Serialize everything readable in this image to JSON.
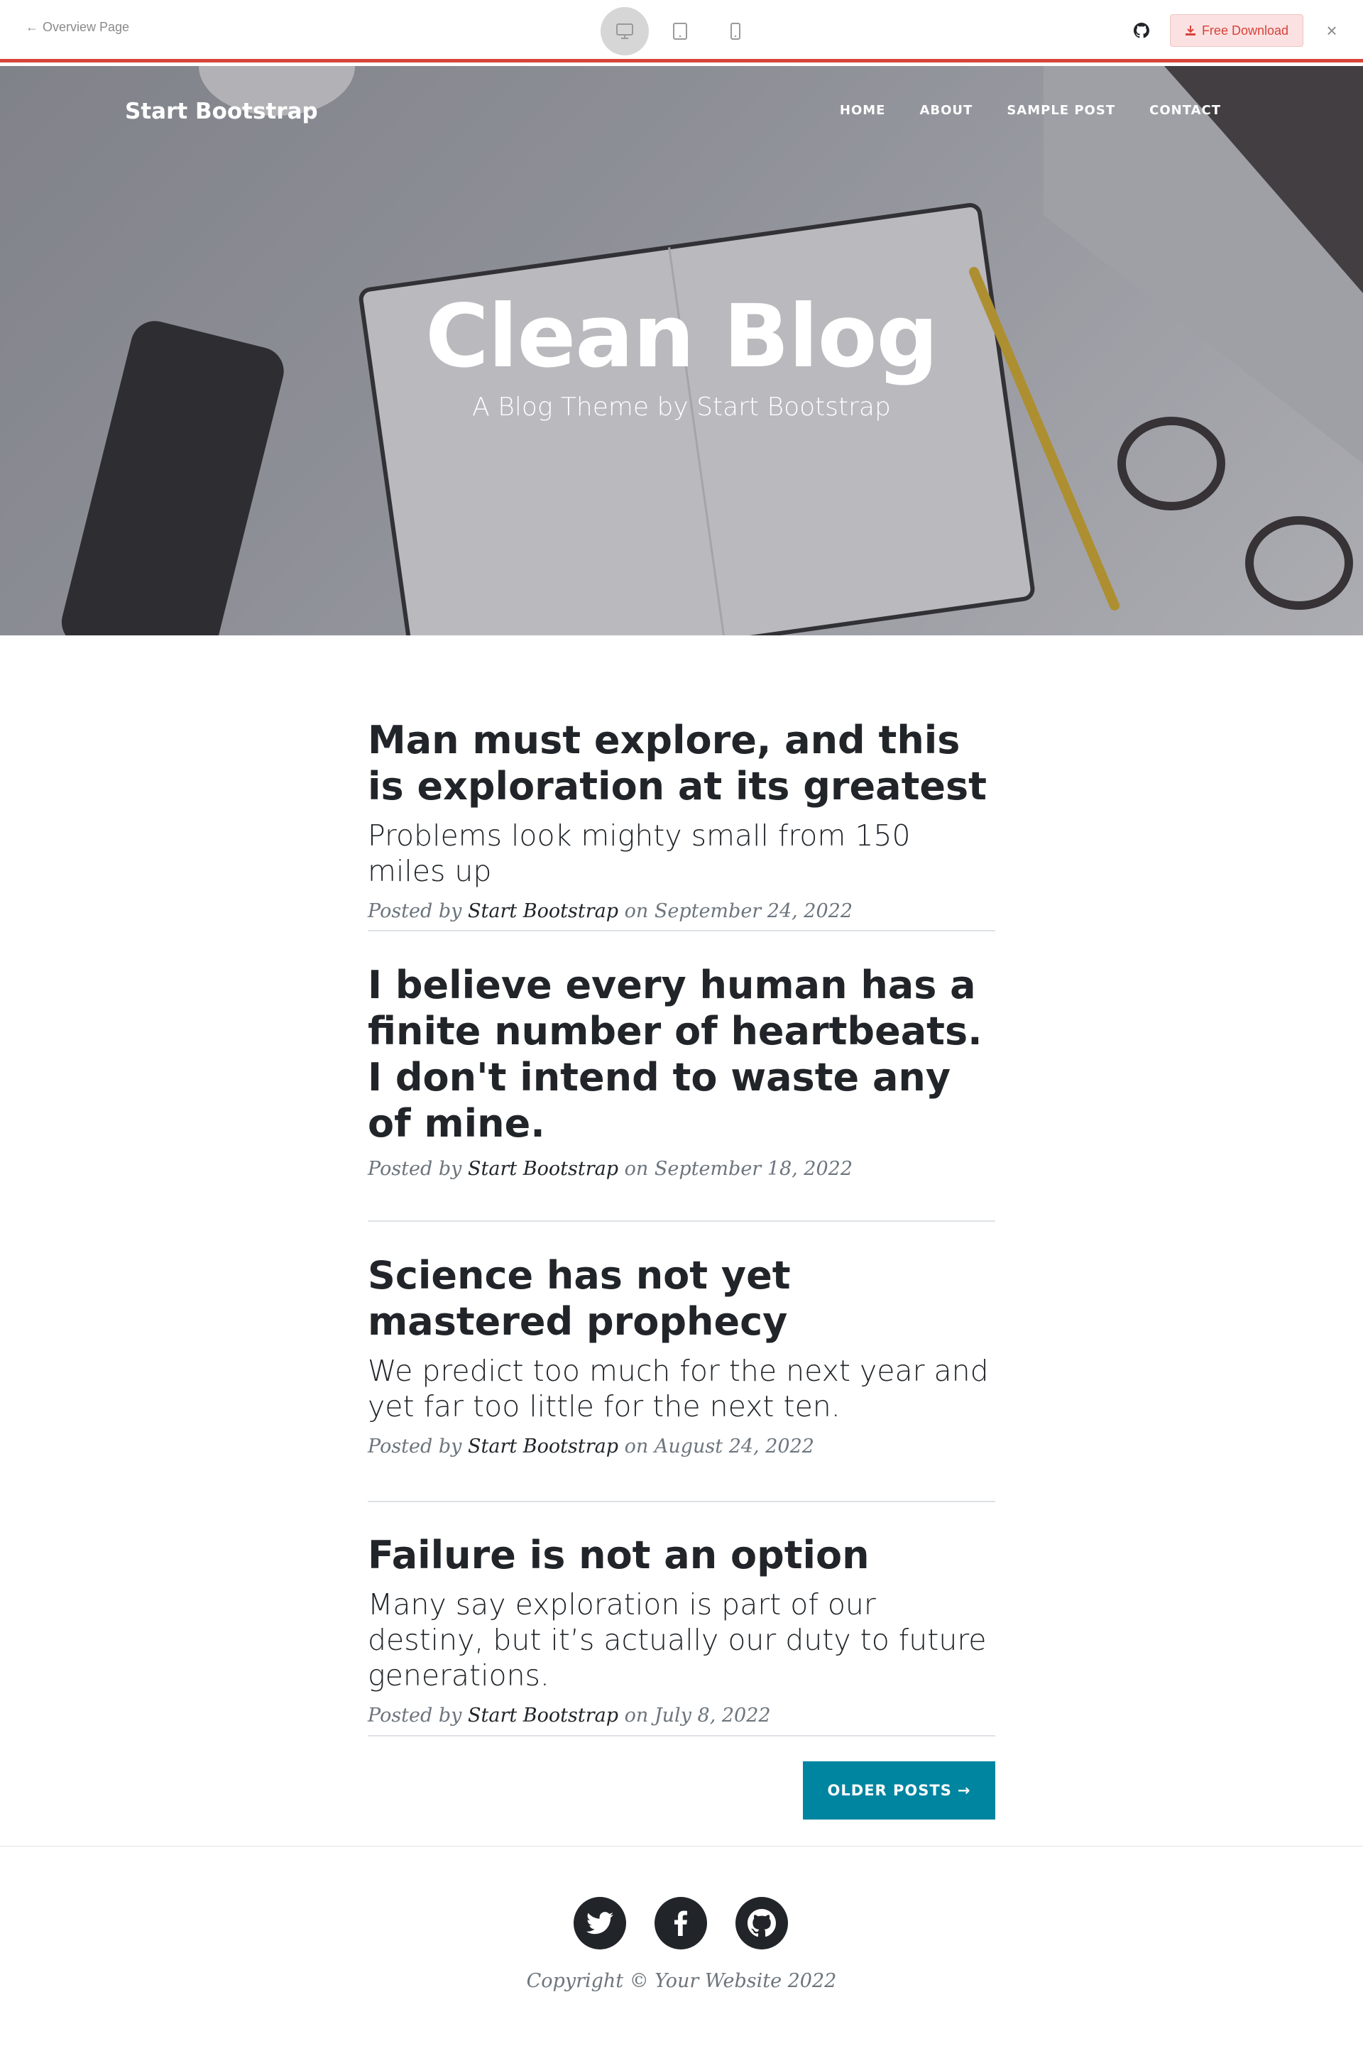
{
  "topbar": {
    "back_label": "Overview Page",
    "download_label": "Free Download",
    "accent_color": "#d9443a"
  },
  "nav": {
    "brand": "Start Bootstrap",
    "links": [
      "HOME",
      "ABOUT",
      "SAMPLE POST",
      "CONTACT"
    ]
  },
  "hero": {
    "title": "Clean Blog",
    "subtitle": "A Blog Theme by Start Bootstrap"
  },
  "posts": [
    {
      "title": "Man must explore, and this is exploration at its greatest",
      "subtitle": "Problems look mighty small from 150 miles up",
      "posted_by": "Posted by",
      "author": "Start Bootstrap",
      "on": "on",
      "date": "September 24, 2022"
    },
    {
      "title": "I believe every human has a finite number of heartbeats. I don't intend to waste any of mine.",
      "subtitle": "",
      "posted_by": "Posted by",
      "author": "Start Bootstrap",
      "on": "on",
      "date": "September 18, 2022"
    },
    {
      "title": "Science has not yet mastered prophecy",
      "subtitle": "We predict too much for the next year and yet far too little for the next ten.",
      "posted_by": "Posted by",
      "author": "Start Bootstrap",
      "on": "on",
      "date": "August 24, 2022"
    },
    {
      "title": "Failure is not an option",
      "subtitle": "Many say exploration is part of our destiny, but it’s actually our duty to future generations.",
      "posted_by": "Posted by",
      "author": "Start Bootstrap",
      "on": "on",
      "date": "July 8, 2022"
    }
  ],
  "pager": {
    "older_label": "OLDER POSTS",
    "arrow": "→",
    "button_color": "#0085a1"
  },
  "footer": {
    "social": [
      "twitter-icon",
      "facebook-icon",
      "github-icon"
    ],
    "copyright": "Copyright © Your Website 2022"
  }
}
